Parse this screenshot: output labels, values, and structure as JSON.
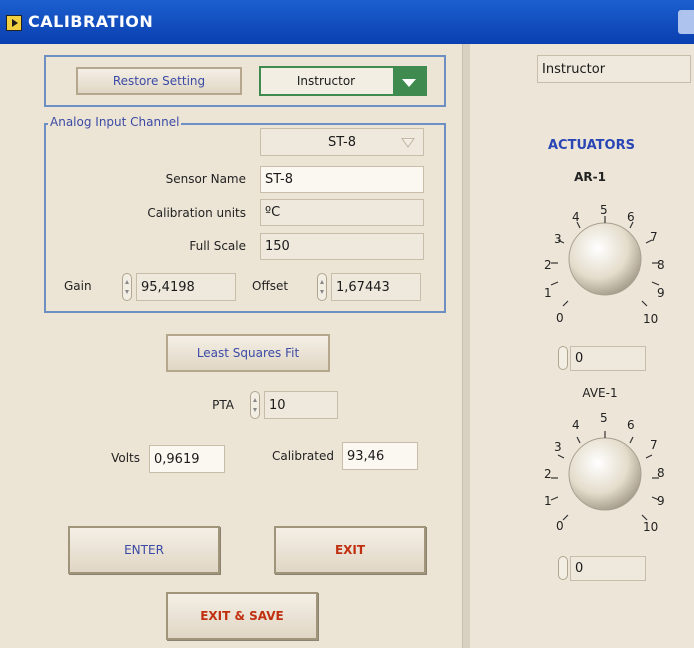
{
  "window": {
    "title": "CALIBRATION"
  },
  "controls": {
    "restore_label": "Restore Setting",
    "role_value": "Instructor"
  },
  "analog": {
    "group_label": "Analog Input Channel",
    "channel_value": "ST-8",
    "sensor_name_label": "Sensor Name",
    "sensor_name_value": "ST-8",
    "units_label": "Calibration units",
    "units_value": "ºC",
    "full_scale_label": "Full Scale",
    "full_scale_value": "150",
    "gain_label": "Gain",
    "gain_value": "95,4198",
    "offset_label": "Offset",
    "offset_value": "1,67443"
  },
  "fit": {
    "button_label": "Least Squares  Fit",
    "pta_label": "PTA",
    "pta_value": "10",
    "volts_label": "Volts",
    "volts_value": "0,9619",
    "calibrated_label": "Calibrated",
    "calibrated_value": "93,46"
  },
  "actions": {
    "enter_label": "ENTER",
    "exit_label": "EXIT",
    "exit_save_label": "EXIT & SAVE"
  },
  "actuators": {
    "user_display": "Instructor",
    "title": "ACTUATORS",
    "knob1_name": "AR-1",
    "knob1_value": "0",
    "knob2_name": "AVE-1",
    "knob2_value": "0",
    "scale": [
      "0",
      "1",
      "2",
      "3",
      "4",
      "5",
      "6",
      "7",
      "8",
      "9",
      "10"
    ]
  },
  "colors": {
    "title_bar": "#0a3fb0",
    "accent_green": "#3f8a4e",
    "label_blue": "#3b4aa5",
    "exit_red": "#c03010"
  }
}
